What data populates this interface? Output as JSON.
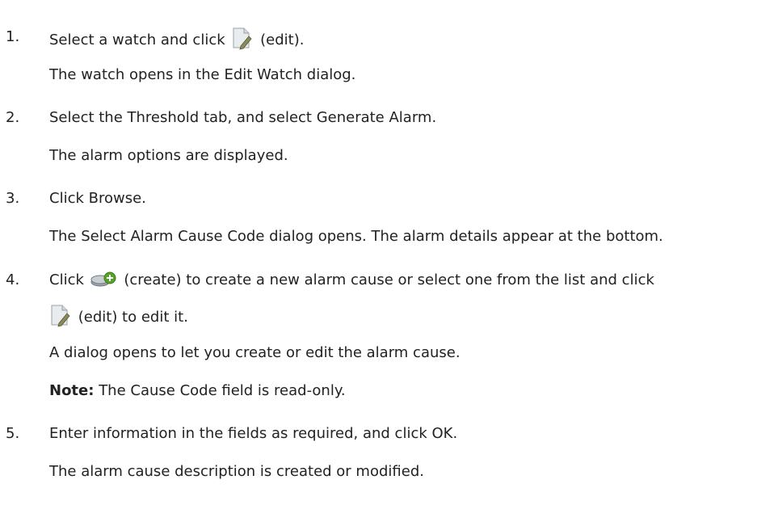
{
  "steps": [
    {
      "number": "1.",
      "before_icon": "Select a watch and click",
      "icon": "edit-icon",
      "after_icon": "(edit).",
      "result": "The watch opens in the Edit Watch dialog."
    },
    {
      "number": "2.",
      "text": "Select the Threshold tab, and select Generate Alarm.",
      "result": "The alarm options are displayed."
    },
    {
      "number": "3.",
      "text": "Click Browse.",
      "result": "The Select Alarm Cause Code dialog opens. The alarm details appear at the bottom."
    },
    {
      "number": "4.",
      "before_icon": "Click",
      "icon": "create-icon",
      "after_icon": "(create) to create a new alarm cause or select one from the list and click",
      "line2_icon": "edit-icon",
      "line2_text": "(edit) to edit it.",
      "result": "A dialog opens to let you create or edit the alarm cause.",
      "note_label": "Note:",
      "note_text": "The Cause Code field is read-only."
    },
    {
      "number": "5.",
      "text": "Enter information in the fields as required, and click OK.",
      "result": "The alarm cause description is created or modified."
    }
  ],
  "colors": {
    "text": "#222222",
    "icon_page": "#e9ecef",
    "icon_pencil": "#8a8a5a",
    "icon_create": "#9aa3ab",
    "icon_plus_badge": "#5aa02c"
  }
}
